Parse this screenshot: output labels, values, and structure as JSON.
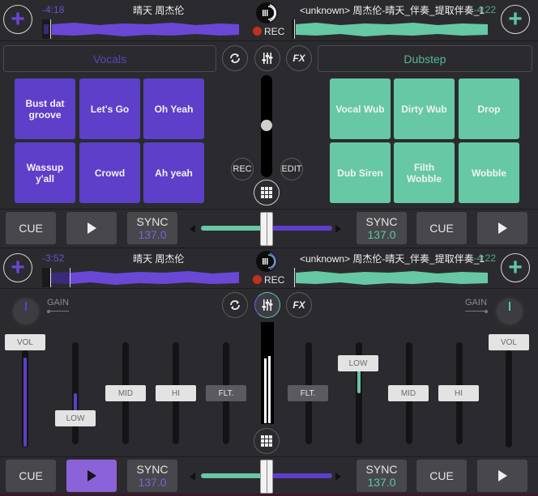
{
  "colors": {
    "background": "#2b2b2f",
    "deck_a_accent": "#5d3fca",
    "deck_b_accent": "#66c8a5",
    "rec_red": "#c0301e"
  },
  "top_deck": {
    "left": {
      "time_remaining": "-4:18",
      "title": "晴天 周杰伦",
      "add_icon": "plus-icon"
    },
    "right": {
      "time_remaining": "-4:22",
      "title": "<unknown> 周杰伦-晴天_伴奏_提取伴奏_1",
      "add_icon": "plus-icon"
    },
    "rec_label": "REC"
  },
  "sampler": {
    "left_category": "Vocals",
    "right_category": "Dubstep",
    "left_pads": [
      "Bust dat groove",
      "Let's Go",
      "Oh Yeah",
      "Wassup y'all",
      "Crowd",
      "Ah yeah"
    ],
    "right_pads": [
      "Vocal Wub",
      "Dirty Wub",
      "Drop",
      "Dub Siren",
      "Filth Wobble",
      "Wobble"
    ],
    "rec_button": "REC",
    "edit_button": "EDIT",
    "fx_button": "FX",
    "volume_level": 0.5
  },
  "transport_top": {
    "left": {
      "cue": "CUE",
      "sync": "SYNC",
      "bpm": "137.0"
    },
    "right": {
      "cue": "CUE",
      "sync": "SYNC",
      "bpm": "137.0"
    },
    "crossfader_position": 0.5
  },
  "bottom_deck": {
    "left": {
      "time_remaining": "-3:52",
      "title": "晴天 周杰伦"
    },
    "right": {
      "time_remaining": "-4:22",
      "title": "<unknown> 周杰伦-晴天_伴奏_提取伴奏_1"
    },
    "rec_label": "REC"
  },
  "mixer": {
    "gain_label": "GAIN",
    "fx_button": "FX",
    "left": {
      "vol": "VOL",
      "low": "LOW",
      "mid": "MID",
      "hi": "HI",
      "flt": "FLT."
    },
    "right": {
      "vol": "VOL",
      "low": "LOW",
      "mid": "MID",
      "hi": "HI",
      "flt": "FLT."
    }
  },
  "transport_bottom": {
    "left": {
      "cue": "CUE",
      "sync": "SYNC",
      "bpm": "137.0",
      "playing": true
    },
    "right": {
      "cue": "CUE",
      "sync": "SYNC",
      "bpm": "137.0",
      "playing": false
    },
    "crossfader_position": 0.5
  }
}
